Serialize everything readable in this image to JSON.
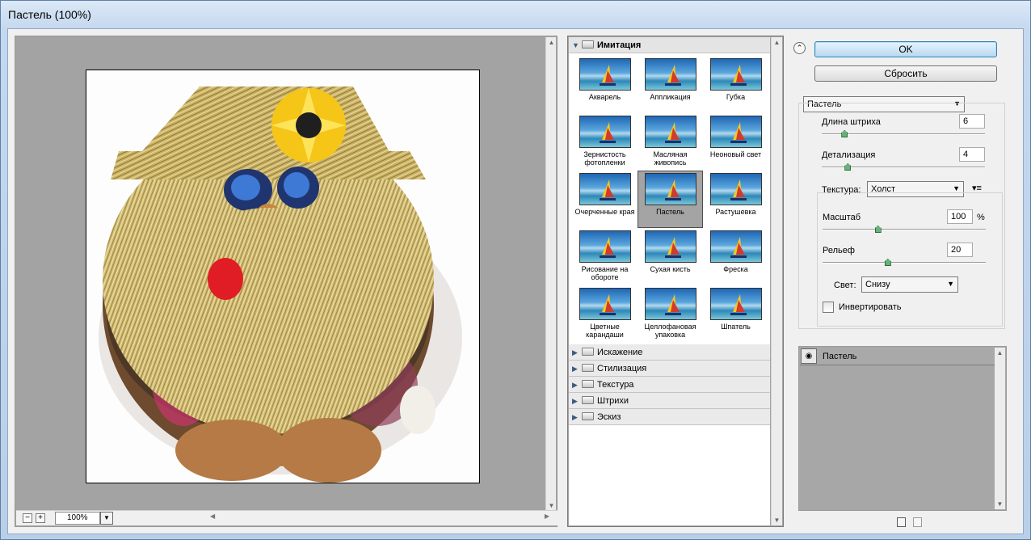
{
  "window": {
    "title": "Пастель (100%)"
  },
  "preview": {
    "zoom_value": "100%",
    "zoom_out_label": "−",
    "zoom_in_label": "+"
  },
  "gallery": {
    "open_category": "Имитация",
    "filters": [
      "Акварель",
      "Аппликация",
      "Губка",
      "Зернистость фотопленки",
      "Масляная живопись",
      "Неоновый свет",
      "Очерченные края",
      "Пастель",
      "Растушевка",
      "Рисование на обороте",
      "Сухая кисть",
      "Фреска",
      "Цветные карандаши",
      "Целлофановая упаковка",
      "Шпатель"
    ],
    "selected_filter": "Пастель",
    "closed_categories": [
      "Искажение",
      "Стилизация",
      "Текстура",
      "Штрихи",
      "Эскиз"
    ]
  },
  "buttons": {
    "ok": "OK",
    "reset": "Сбросить"
  },
  "settings": {
    "filter_select": "Пастель",
    "stroke_length_label": "Длина штриха",
    "stroke_length_value": "6",
    "stroke_length_fraction": 0.14,
    "detail_label": "Детализация",
    "detail_value": "4",
    "detail_fraction": 0.16,
    "texture_label": "Текстура:",
    "texture_value": "Холст",
    "scale_label": "Масштаб",
    "scale_value": "100",
    "scale_unit": "%",
    "scale_fraction": 0.34,
    "relief_label": "Рельеф",
    "relief_value": "20",
    "relief_fraction": 0.4,
    "light_label": "Свет:",
    "light_value": "Снизу",
    "invert_label": "Инвертировать",
    "invert_checked": false
  },
  "layers": {
    "items": [
      "Пастель"
    ]
  }
}
